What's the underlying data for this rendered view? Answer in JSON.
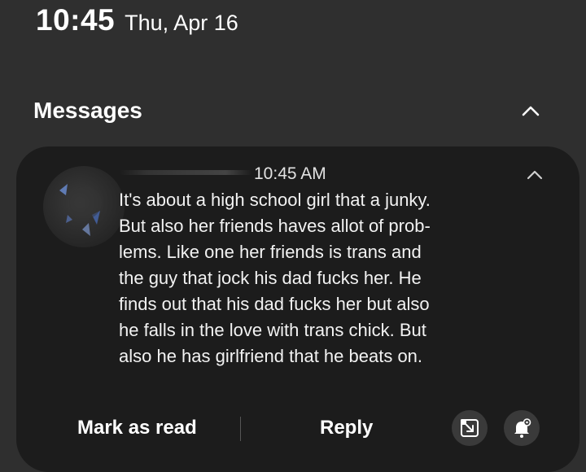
{
  "status_bar": {
    "time": "10:45",
    "date": "Thu, Apr 16"
  },
  "section": {
    "title": "Messages",
    "collapse_icon": "chevron-up-icon"
  },
  "notification": {
    "time": "10:45 AM",
    "collapse_icon": "chevron-up-icon",
    "message_lines": [
      "It's about a high school girl that a junky.",
      "But also her friends haves allot of prob-",
      "lems. Like one her friends is trans and",
      "the guy that jock his dad fucks her. He",
      "finds out that his dad fucks her but also",
      "he falls in the love with trans chick. But",
      "also he has girlfriend that he beats on."
    ],
    "actions": {
      "mark_as_read": "Mark as read",
      "reply": "Reply",
      "popup_icon": "open-in-popup-icon",
      "bell_icon": "notification-settings-bell-icon"
    }
  },
  "colors": {
    "background": "#2f2f2f",
    "card": "#1c1c1c",
    "text": "#ffffff"
  }
}
